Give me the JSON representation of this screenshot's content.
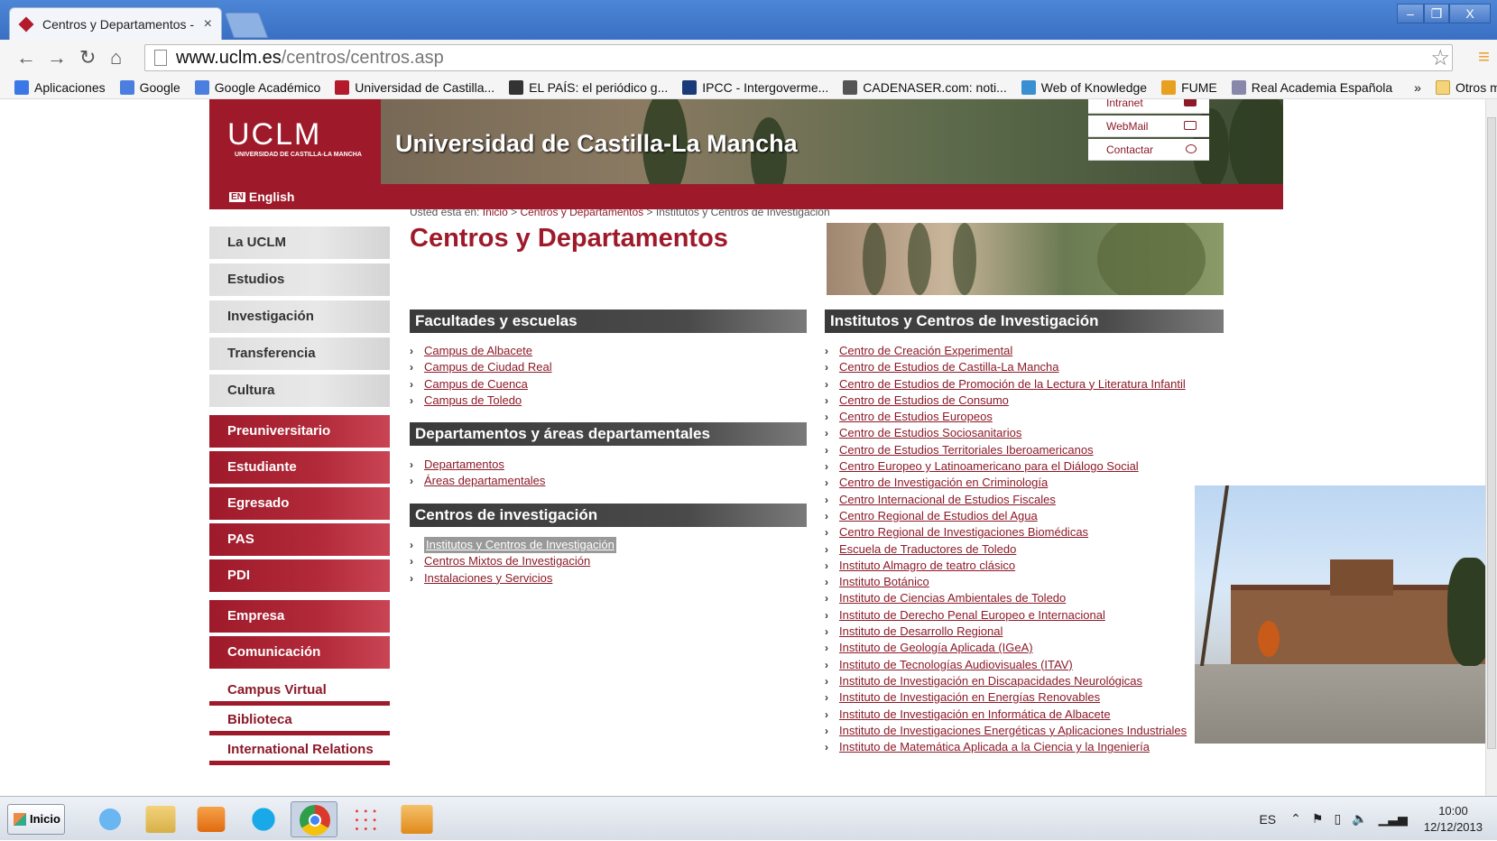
{
  "browser": {
    "tab_title": "Centros y Departamentos - U",
    "tab_close": "×",
    "url_host": "www.uclm.es",
    "url_path": "/centros/centros.asp",
    "window_buttons": [
      "–",
      "❐",
      "X"
    ]
  },
  "bookmarks": [
    {
      "label": "Aplicaciones",
      "color": "#3b78e7"
    },
    {
      "label": "Google",
      "color": "#4a7fe0"
    },
    {
      "label": "Google Académico",
      "color": "#4a7fe0"
    },
    {
      "label": "Universidad de Castilla...",
      "color": "#b31b2c"
    },
    {
      "label": "EL PAÍS: el periódico g...",
      "color": "#333333"
    },
    {
      "label": "IPCC - Intergoverme...",
      "color": "#1a3b7a"
    },
    {
      "label": "CADENASER.com: noti...",
      "color": "#555555"
    },
    {
      "label": "Web of Knowledge",
      "color": "#3a8fd0"
    },
    {
      "label": "FUME",
      "color": "#e8a020"
    },
    {
      "label": "Real Academia Española",
      "color": "#8888aa"
    }
  ],
  "bookmarks_more": "»",
  "bookmarks_other": "Otros marcadores",
  "header": {
    "logo": "UCLM",
    "logo_sub": "UNIVERSIDAD DE CASTILLA-LA MANCHA",
    "university_name": "Universidad de Castilla-La Mancha",
    "utility_links": [
      "Intranet",
      "WebMail",
      "Contactar"
    ],
    "english_badge": "EN",
    "english_label": "English"
  },
  "left_nav": {
    "grey_items": [
      "La UCLM",
      "Estudios",
      "Investigación",
      "Transferencia",
      "Cultura"
    ],
    "red_items": [
      "Preuniversitario",
      "Estudiante",
      "Egresado",
      "PAS",
      "PDI",
      "Empresa",
      "Comunicación"
    ],
    "white_items": [
      "Campus Virtual",
      "Biblioteca",
      "International Relations"
    ]
  },
  "breadcrumb": {
    "prefix": "Usted está en:",
    "items": [
      "Inicio",
      "Centros y Departamentos",
      "Institutos y Centros de Investigación"
    ],
    "separator": ">"
  },
  "page_title": "Centros y Departamentos",
  "sections": {
    "facultades": {
      "title": "Facultades y escuelas",
      "links": [
        "Campus de Albacete",
        "Campus de Ciudad Real",
        "Campus de Cuenca",
        "Campus de Toledo"
      ]
    },
    "departamentos": {
      "title": "Departamentos y áreas departamentales",
      "links": [
        "Departamentos",
        "Áreas departamentales"
      ]
    },
    "centros": {
      "title": "Centros de investigación",
      "links": [
        "Institutos y Centros de Investigación",
        "Centros Mixtos de Investigación",
        "Instalaciones y Servicios"
      ]
    },
    "institutos": {
      "title": "Institutos y Centros de Investigación",
      "links": [
        "Centro de Creación Experimental",
        "Centro de Estudios de Castilla-La Mancha",
        "Centro de Estudios de Promoción de la Lectura y Literatura Infantil",
        "Centro de Estudios de Consumo",
        "Centro de Estudios Europeos",
        "Centro de Estudios Sociosanitarios",
        "Centro de Estudios Territoriales Iberoamericanos",
        "Centro Europeo y Latinoamericano para el Diálogo Social",
        "Centro de Investigación en Criminología",
        "Centro Internacional de Estudios Fiscales",
        "Centro Regional de Estudios del Agua",
        "Centro Regional de Investigaciones Biomédicas",
        "Escuela de Traductores de Toledo",
        "Instituto Almagro de teatro clásico",
        "Instituto Botánico",
        "Instituto de Ciencias Ambientales de Toledo",
        "Instituto de Derecho Penal Europeo e Internacional",
        "Instituto de Desarrollo Regional",
        "Instituto de Geología Aplicada (IGeA)",
        "Instituto de Tecnologías Audiovisuales (ITAV)",
        "Instituto de Investigación en Discapacidades Neurológicas",
        "Instituto de Investigación en Energías Renovables",
        "Instituto de Investigación en Informática de Albacete",
        "Instituto de Investigaciones Energéticas y Aplicaciones Industriales",
        "Instituto de Matemática Aplicada a la Ciencia y la Ingeniería"
      ]
    }
  },
  "taskbar": {
    "start_label": "Inicio",
    "apps": [
      "internet-explorer",
      "file-explorer",
      "media-player",
      "skype",
      "chrome",
      "apps-grid",
      "outlook"
    ],
    "language": "ES",
    "time": "10:00",
    "date": "12/12/2013"
  },
  "colors": {
    "brand_red": "#9e1a2a",
    "link_red": "#8c1a28",
    "section_dark": "#3a3a3a"
  }
}
